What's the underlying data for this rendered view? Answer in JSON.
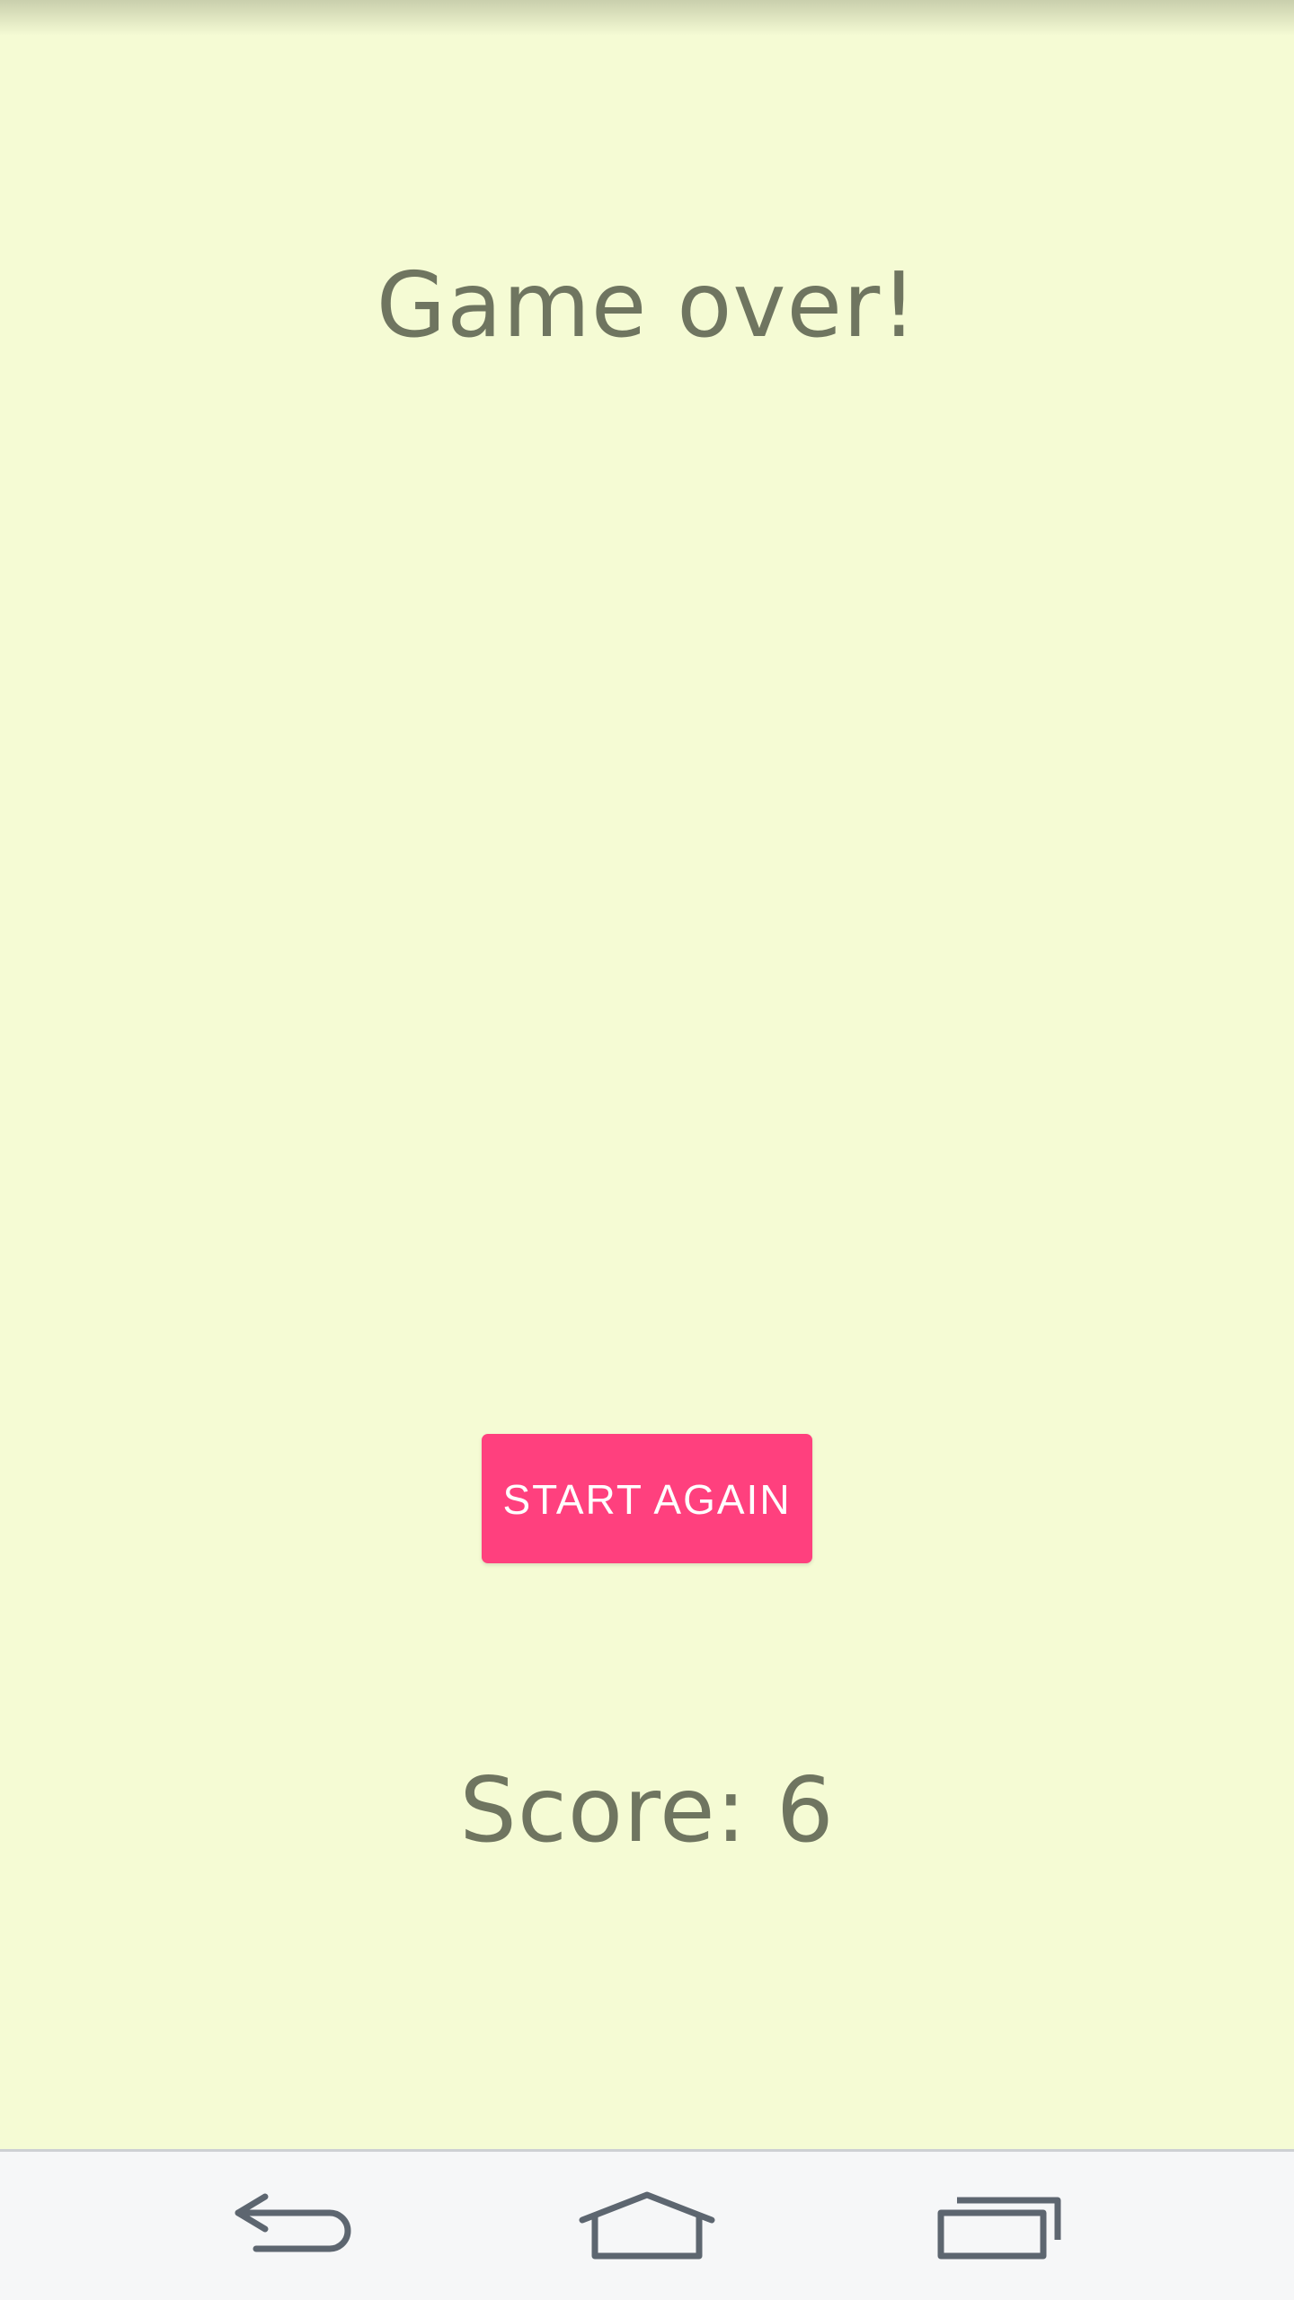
{
  "screen": {
    "title": "Game over!",
    "start_again_label": "START AGAIN",
    "score_text": "Score: 6"
  },
  "colors": {
    "background": "#f5fbd4",
    "text": "#6f7560",
    "accent": "#ff407e",
    "navbar": "#f6f7f8",
    "nav_icon": "#5d6670"
  },
  "navbar": {
    "icons": [
      "back-icon",
      "home-icon",
      "recents-icon"
    ]
  }
}
